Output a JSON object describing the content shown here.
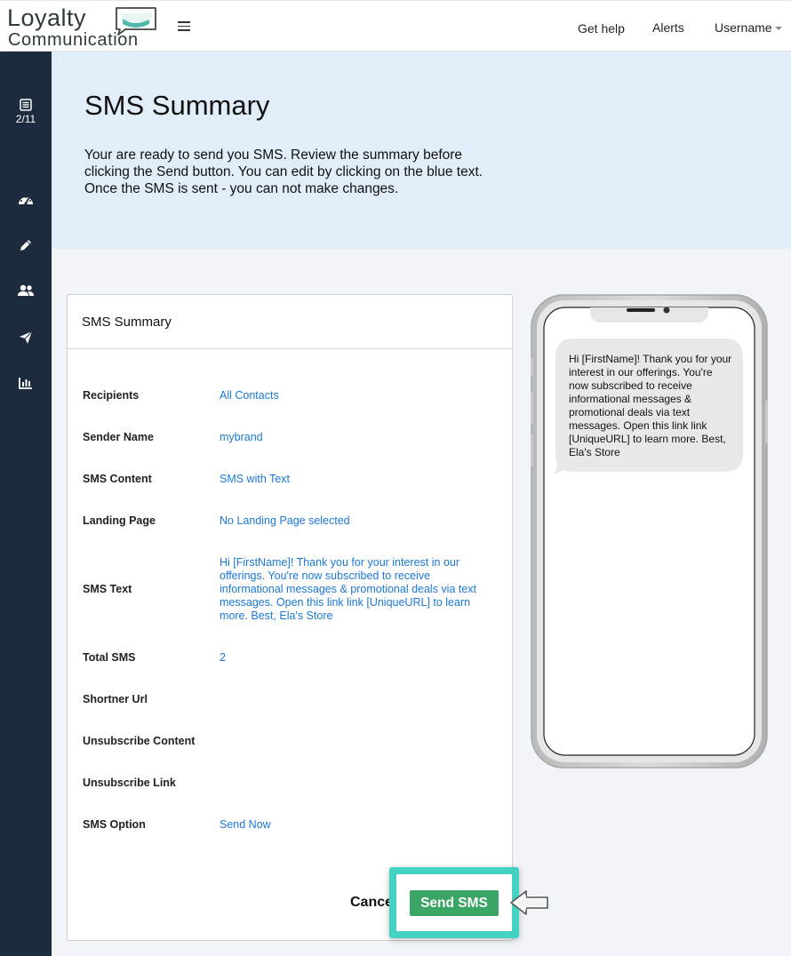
{
  "brand": {
    "line1": "Loyalty",
    "line2": "Communication",
    "accent": "#4fb8a8"
  },
  "topnav": {
    "help": "Get help",
    "alerts": "Alerts",
    "user": "Username"
  },
  "sidebar": {
    "step": "2/11",
    "icons": [
      "list-icon",
      "dashboard-icon",
      "pencil-icon",
      "users-icon",
      "send-icon",
      "bar-chart-icon"
    ]
  },
  "hero": {
    "title": "SMS Summary",
    "line1": "Your are ready to send you SMS. Review the summary before",
    "line2": "clicking the Send button. You can edit by clicking on the blue text.",
    "line3": "Once the SMS is sent - you can not make changes."
  },
  "summary": {
    "title": "SMS Summary",
    "rows": [
      {
        "label": "Recipients",
        "value": "All Contacts"
      },
      {
        "label": "Sender Name",
        "value": "mybrand"
      },
      {
        "label": "SMS Content",
        "value": "SMS with Text"
      },
      {
        "label": "Landing Page",
        "value": "No Landing Page selected"
      },
      {
        "label": "SMS Text",
        "value": "Hi [FirstName]! Thank you for your interest in our offerings. You're now subscribed to receive informational messages & promotional deals via text messages. Open this link link [UniqueURL] to learn more. Best, Ela's Store"
      },
      {
        "label": "Total SMS",
        "value": "2"
      },
      {
        "label": "Shortner Url",
        "value": ""
      },
      {
        "label": "Unsubscribe Content",
        "value": ""
      },
      {
        "label": "Unsubscribe Link",
        "value": ""
      },
      {
        "label": "SMS Option",
        "value": "Send Now"
      }
    ]
  },
  "actions": {
    "cancel": "Cancel",
    "send": "Send SMS",
    "send_color": "#3aa564",
    "highlight_color": "#43d1c2"
  },
  "preview": {
    "message": "Hi [FirstName]! Thank you for your interest in our offerings. You're now subscribed to receive informational messages & promotional deals via text messages. Open this link link [UniqueURL] to learn more. Best, Ela's Store"
  }
}
